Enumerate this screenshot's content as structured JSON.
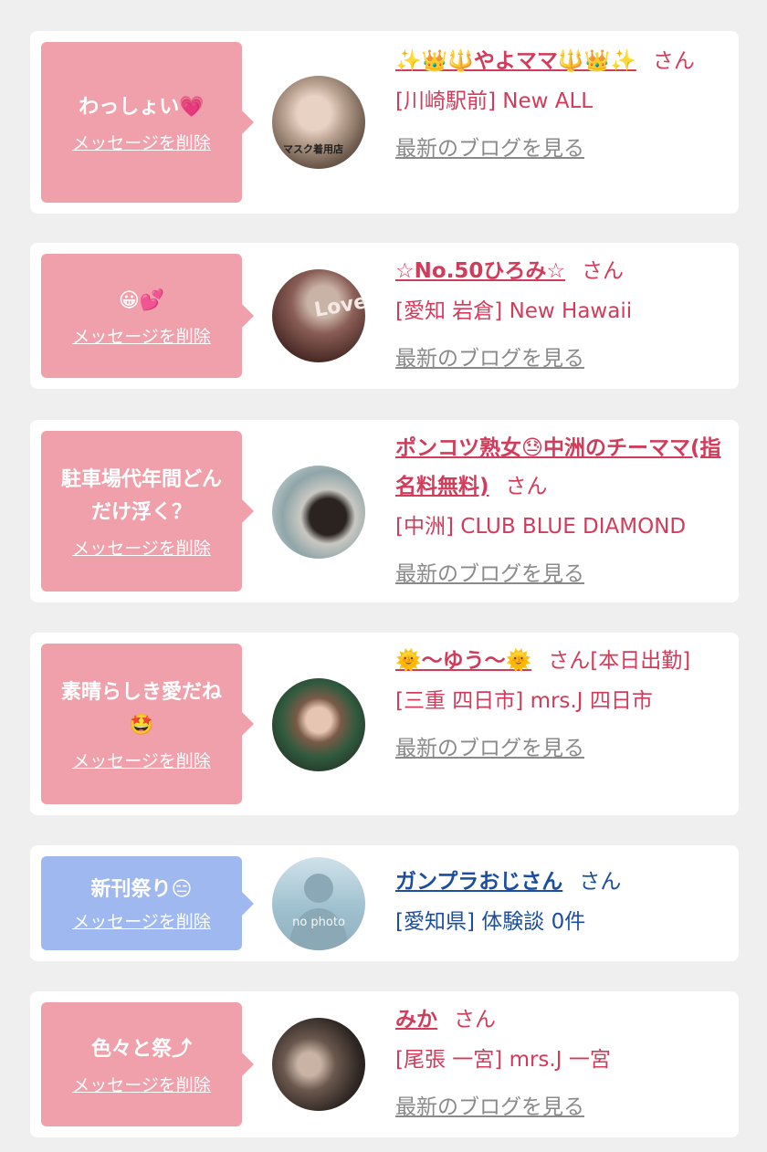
{
  "delete_label": "メッセージを削除",
  "blog_label": "最新のブログを見る",
  "san_label": "さん",
  "cards": [
    {
      "message": "わっしょい💗",
      "name": "✨👑🔱やよママ🔱👑✨",
      "suffix": "",
      "shop": "[川崎駅前] New ALL",
      "theme": "pink"
    },
    {
      "message": "😀💕",
      "name": "☆No.50ひろみ☆",
      "suffix": "",
      "shop": "[愛知 岩倉] New Hawaii",
      "theme": "pink"
    },
    {
      "message": "駐車場代年間どんだけ浮く？",
      "name": "ポンコツ熟女😓中洲のチーママ(指名料無料)",
      "suffix": "",
      "shop": "[中洲] CLUB BLUE DIAMOND",
      "theme": "pink"
    },
    {
      "message": "素晴らしき愛だね🤩",
      "name": "🌞〜ゆう〜🌞",
      "suffix": "[本日出勤]",
      "shop": "[三重 四日市] mrs.J 四日市",
      "theme": "pink"
    },
    {
      "message": "新刊祭り😑",
      "name": "ガンプラおじさん",
      "suffix": "",
      "shop": "[愛知県] 体験談 0件",
      "theme": "blue",
      "avatar_text": "no photo"
    },
    {
      "message": "色々と祭⤴",
      "name": "みか",
      "suffix": "",
      "shop": "[尾張 一宮] mrs.J 一宮",
      "theme": "pink"
    }
  ],
  "colors": {
    "pink_bubble": "#f0a0ab",
    "blue_bubble": "#9fb8f0",
    "pink_text": "#d23c5a",
    "blue_text": "#1b4ea0",
    "background": "#efefef"
  }
}
